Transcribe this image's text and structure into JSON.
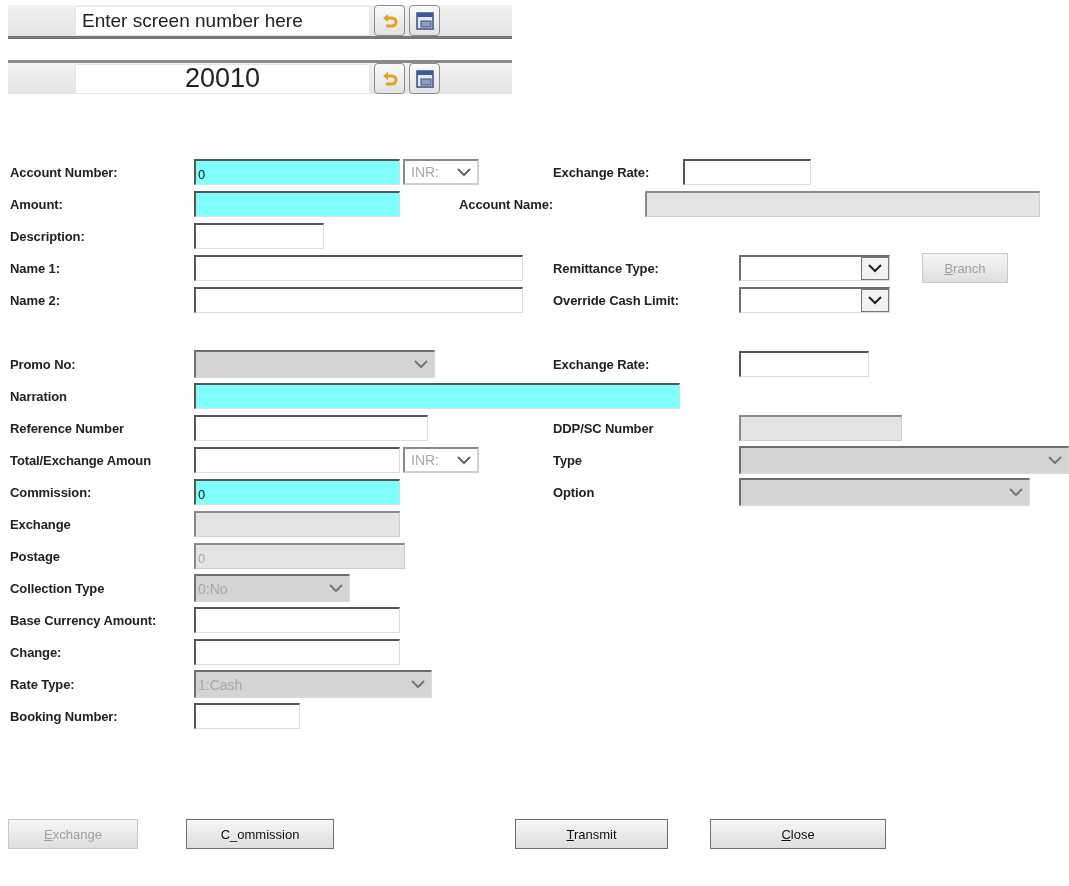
{
  "screen_bars": [
    {
      "placeholder": "Enter screen number here"
    },
    {
      "value": "20010"
    }
  ],
  "sections": [
    {
      "rows": [
        {
          "left": {
            "label": "Account Number:",
            "field": {
              "kind": "text",
              "value": "0",
              "required": true,
              "disabled": false
            },
            "currency": {
              "value": "INR:",
              "disabled": true
            }
          },
          "right": {
            "label": "Exchange Rate:",
            "field": {
              "kind": "text",
              "required": false,
              "disabled": false
            }
          }
        },
        {
          "left": {
            "label": "Amount:",
            "field": {
              "kind": "text",
              "required": true,
              "disabled": false
            }
          },
          "right": {
            "label": "Account Name:",
            "field": {
              "kind": "text",
              "required": false,
              "disabled": true
            }
          }
        },
        {
          "left": {
            "label": "Description:",
            "field": {
              "kind": "text",
              "required": false,
              "disabled": false
            }
          }
        },
        {
          "left": {
            "label": "Name 1:",
            "field": {
              "kind": "text",
              "required": false,
              "disabled": false
            }
          },
          "right": {
            "label": "Remittance Type:",
            "field": {
              "kind": "combo",
              "disabled": false
            },
            "button": {
              "label": {
                "key": "B",
                "post": "ranch"
              },
              "disabled": true
            }
          }
        },
        {
          "left": {
            "label": "Name 2:",
            "field": {
              "kind": "text",
              "required": false,
              "disabled": false
            }
          },
          "right": {
            "label": "Override Cash Limit:",
            "field": {
              "kind": "combo",
              "disabled": false
            }
          }
        }
      ]
    },
    {
      "rows": [
        {
          "left": {
            "label": "Promo No:",
            "field": {
              "kind": "dropdown",
              "disabled": true
            }
          },
          "right": {
            "label": "Exchange Rate:",
            "field": {
              "kind": "text",
              "required": false,
              "disabled": false
            }
          }
        },
        {
          "left": {
            "label": "Narration",
            "field": {
              "kind": "text",
              "required": true,
              "disabled": false
            }
          }
        },
        {
          "left": {
            "label": "Reference Number",
            "field": {
              "kind": "text",
              "required": false,
              "disabled": false
            }
          },
          "right": {
            "label": "DDP/SC Number",
            "field": {
              "kind": "text",
              "required": false,
              "disabled": true
            }
          }
        },
        {
          "left": {
            "label": "Total/Exchange Amoun",
            "field": {
              "kind": "text",
              "required": false,
              "disabled": false
            },
            "currency": {
              "value": "INR:",
              "disabled": true
            }
          },
          "right": {
            "label": "Type",
            "field": {
              "kind": "dropdown",
              "disabled": true
            }
          }
        },
        {
          "left": {
            "label": "Commission:",
            "field": {
              "kind": "text",
              "value": "0",
              "required": true,
              "disabled": false
            }
          },
          "right": {
            "label": "Option",
            "field": {
              "kind": "dropdown",
              "disabled": true
            }
          }
        },
        {
          "left": {
            "label": "Exchange",
            "field": {
              "kind": "text",
              "required": false,
              "disabled": true
            }
          }
        },
        {
          "left": {
            "label": "Postage",
            "field": {
              "kind": "text",
              "value": "0",
              "required": false,
              "disabled": true
            }
          }
        },
        {
          "left": {
            "label": "Collection Type",
            "field": {
              "kind": "dropdown",
              "value": "0:No",
              "disabled": true
            }
          }
        },
        {
          "left": {
            "label": "Base Currency Amount:",
            "field": {
              "kind": "text",
              "required": false,
              "disabled": false
            }
          }
        },
        {
          "left": {
            "label": "Change:",
            "field": {
              "kind": "text",
              "required": false,
              "disabled": false
            }
          }
        },
        {
          "left": {
            "label": "Rate Type:",
            "field": {
              "kind": "dropdown",
              "value": "1:Cash",
              "disabled": true
            }
          }
        },
        {
          "left": {
            "label": "Booking Number:",
            "field": {
              "kind": "text",
              "required": false,
              "disabled": false
            }
          }
        }
      ]
    }
  ],
  "buttons": [
    {
      "label": {
        "key": "E",
        "post": "xchange"
      },
      "disabled": true
    },
    {
      "label": {
        "pre": "C_ommission"
      },
      "disabled": false
    },
    {
      "label": {
        "key": "T",
        "post": "ransmit"
      },
      "disabled": false
    },
    {
      "label": {
        "key": "C",
        "post": "lose"
      },
      "disabled": false
    }
  ]
}
